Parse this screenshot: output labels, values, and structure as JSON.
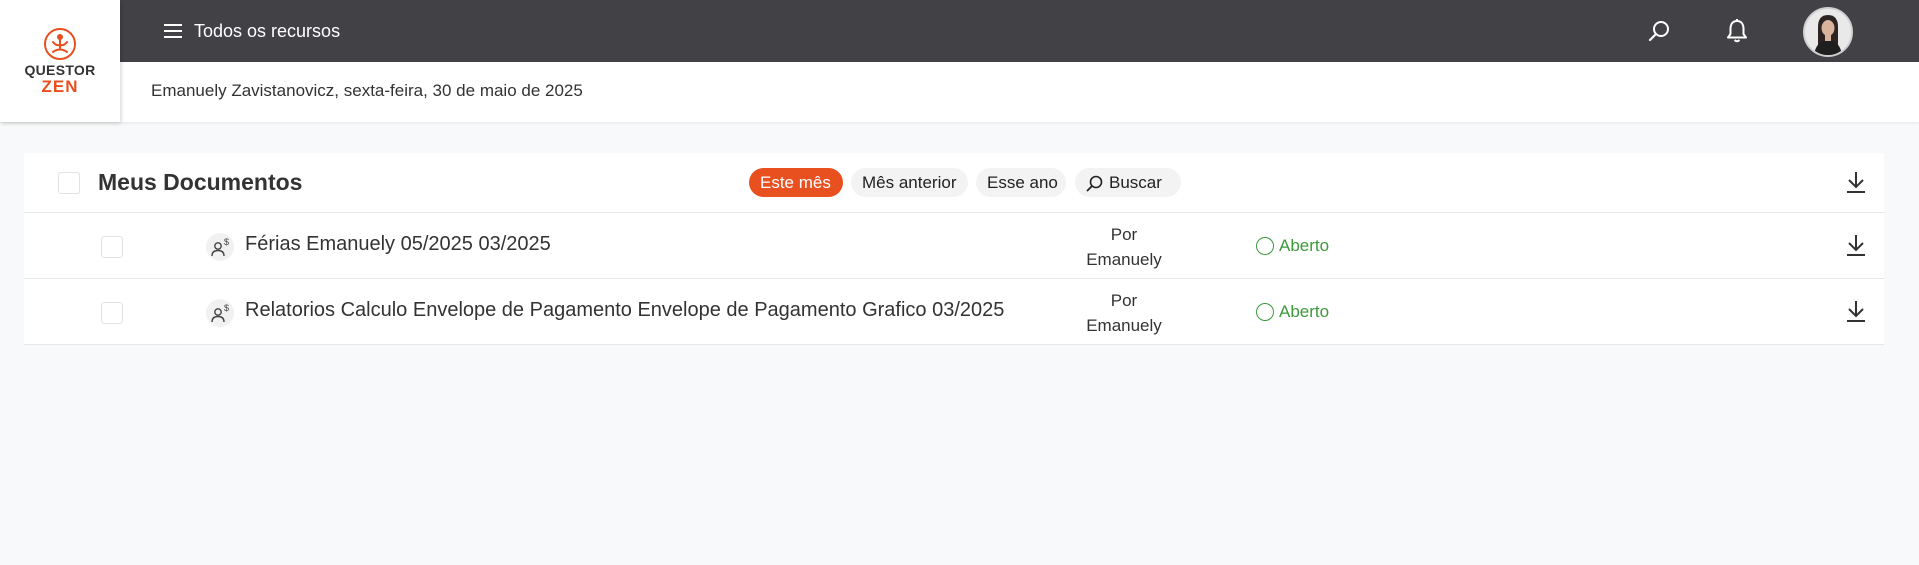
{
  "logo": {
    "brand_top": "QUESTOR",
    "brand_bottom": "ZEN"
  },
  "topbar": {
    "menu_label": "Todos os recursos",
    "icons": [
      "search-icon",
      "bell-icon"
    ]
  },
  "subbar": {
    "greeting": "Emanuely Zavistanovicz, sexta-feira, 30 de maio de 2025"
  },
  "panel": {
    "title": "Meus Documentos",
    "filters": [
      {
        "label": "Este mês",
        "active": true
      },
      {
        "label": "Mês anterior",
        "active": false
      },
      {
        "label": "Esse ano",
        "active": false
      },
      {
        "label": "Buscar",
        "active": false
      }
    ],
    "rows": [
      {
        "title": "Férias Emanuely 05/2025 03/2025",
        "by_prefix": "Por",
        "by_name": "Emanuely",
        "status": "Aberto"
      },
      {
        "title": "Relatorios Calculo Envelope de Pagamento Envelope de Pagamento Grafico 03/2025",
        "by_prefix": "Por",
        "by_name": "Emanuely",
        "status": "Aberto"
      }
    ]
  },
  "colors": {
    "topbar": "#424146",
    "accent": "#e8501f",
    "status_open": "#3d9a3a"
  }
}
